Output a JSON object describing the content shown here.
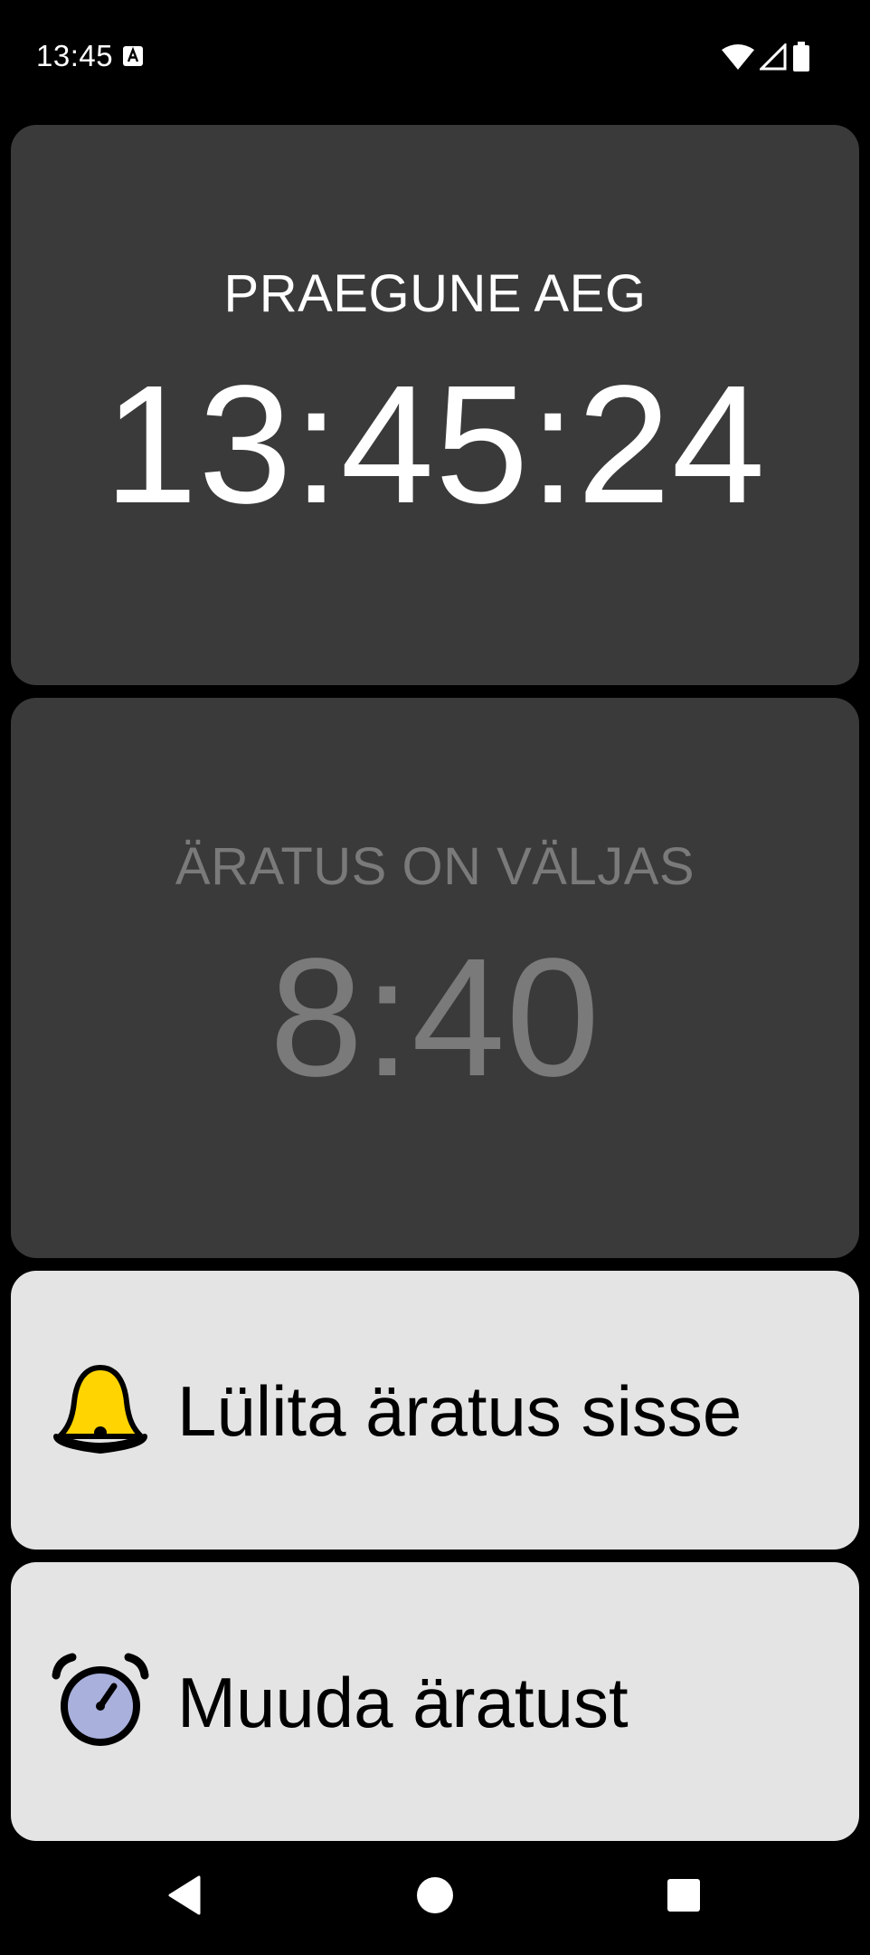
{
  "status_bar": {
    "time": "13:45",
    "icons": [
      "app-notification-icon",
      "wifi-icon",
      "cellular-signal-icon",
      "battery-icon"
    ]
  },
  "clock_card": {
    "label": "PRAEGUNE AEG",
    "time": "13:45:24"
  },
  "alarm_card": {
    "label": "ÄRATUS ON VÄLJAS",
    "time": "8:40"
  },
  "actions": {
    "toggle_alarm": {
      "label": "Lülita äratus sisse",
      "icon": "bell-icon"
    },
    "change_alarm": {
      "label": "Muuda äratust",
      "icon": "alarm-clock-icon"
    }
  },
  "nav_bar": {
    "buttons": [
      "back-icon",
      "home-icon",
      "recents-icon"
    ]
  },
  "colors": {
    "background": "#000000",
    "card_dark": "#3a3a3a",
    "card_light": "#e4e4e4",
    "inactive_text": "#7a7a7a",
    "bell_yellow": "#ffd400",
    "alarm_clock_face": "#a9b0dc"
  }
}
